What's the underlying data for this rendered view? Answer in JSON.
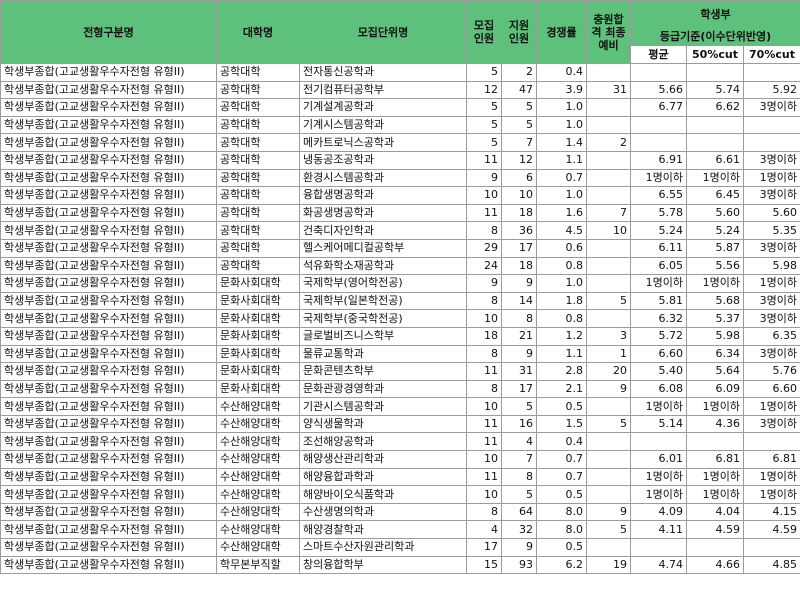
{
  "headers": {
    "track": "전형구분명",
    "college": "대학명",
    "unit": "모집단위명",
    "quota": "모집 인원",
    "applicants": "지원 인원",
    "ratio": "경쟁률",
    "waitlist": "충원합격 최종예비",
    "student_group": "학생부",
    "grade_basis": "등급기준(이수단위반영)",
    "avg": "평균",
    "cut50": "50%cut",
    "cut70": "70%cut"
  },
  "rows": [
    [
      "학생부종합(고교생활우수자전형 유형II)",
      "공학대학",
      "전자통신공학과",
      "5",
      "2",
      "0.4",
      "",
      "",
      "",
      ""
    ],
    [
      "학생부종합(고교생활우수자전형 유형II)",
      "공학대학",
      "전기컴퓨터공학부",
      "12",
      "47",
      "3.9",
      "31",
      "5.66",
      "5.74",
      "5.92"
    ],
    [
      "학생부종합(고교생활우수자전형 유형II)",
      "공학대학",
      "기계설계공학과",
      "5",
      "5",
      "1.0",
      "",
      "6.77",
      "6.62",
      "3명이하"
    ],
    [
      "학생부종합(고교생활우수자전형 유형II)",
      "공학대학",
      "기계시스템공학과",
      "5",
      "5",
      "1.0",
      "",
      "",
      "",
      ""
    ],
    [
      "학생부종합(고교생활우수자전형 유형II)",
      "공학대학",
      "메카트로닉스공학과",
      "5",
      "7",
      "1.4",
      "2",
      "",
      "",
      ""
    ],
    [
      "학생부종합(고교생활우수자전형 유형II)",
      "공학대학",
      "냉동공조공학과",
      "11",
      "12",
      "1.1",
      "",
      "6.91",
      "6.61",
      "3명이하"
    ],
    [
      "학생부종합(고교생활우수자전형 유형II)",
      "공학대학",
      "환경시스템공학과",
      "9",
      "6",
      "0.7",
      "",
      "1명이하",
      "1명이하",
      "1명이하"
    ],
    [
      "학생부종합(고교생활우수자전형 유형II)",
      "공학대학",
      "융합생명공학과",
      "10",
      "10",
      "1.0",
      "",
      "6.55",
      "6.45",
      "3명이하"
    ],
    [
      "학생부종합(고교생활우수자전형 유형II)",
      "공학대학",
      "화공생명공학과",
      "11",
      "18",
      "1.6",
      "7",
      "5.78",
      "5.60",
      "5.60"
    ],
    [
      "학생부종합(고교생활우수자전형 유형II)",
      "공학대학",
      "건축디자인학과",
      "8",
      "36",
      "4.5",
      "10",
      "5.24",
      "5.24",
      "5.35"
    ],
    [
      "학생부종합(고교생활우수자전형 유형II)",
      "공학대학",
      "헬스케어메디컬공학부",
      "29",
      "17",
      "0.6",
      "",
      "6.11",
      "5.87",
      "3명이하"
    ],
    [
      "학생부종합(고교생활우수자전형 유형II)",
      "공학대학",
      "석유화학소재공학과",
      "24",
      "18",
      "0.8",
      "",
      "6.05",
      "5.56",
      "5.98"
    ],
    [
      "학생부종합(고교생활우수자전형 유형II)",
      "문화사회대학",
      "국제학부(영어학전공)",
      "9",
      "9",
      "1.0",
      "",
      "1명이하",
      "1명이하",
      "1명이하"
    ],
    [
      "학생부종합(고교생활우수자전형 유형II)",
      "문화사회대학",
      "국제학부(일본학전공)",
      "8",
      "14",
      "1.8",
      "5",
      "5.81",
      "5.68",
      "3명이하"
    ],
    [
      "학생부종합(고교생활우수자전형 유형II)",
      "문화사회대학",
      "국제학부(중국학전공)",
      "10",
      "8",
      "0.8",
      "",
      "6.32",
      "5.37",
      "3명이하"
    ],
    [
      "학생부종합(고교생활우수자전형 유형II)",
      "문화사회대학",
      "글로벌비즈니스학부",
      "18",
      "21",
      "1.2",
      "3",
      "5.72",
      "5.98",
      "6.35"
    ],
    [
      "학생부종합(고교생활우수자전형 유형II)",
      "문화사회대학",
      "물류교통학과",
      "8",
      "9",
      "1.1",
      "1",
      "6.60",
      "6.34",
      "3명이하"
    ],
    [
      "학생부종합(고교생활우수자전형 유형II)",
      "문화사회대학",
      "문화콘텐츠학부",
      "11",
      "31",
      "2.8",
      "20",
      "5.40",
      "5.64",
      "5.76"
    ],
    [
      "학생부종합(고교생활우수자전형 유형II)",
      "문화사회대학",
      "문화관광경영학과",
      "8",
      "17",
      "2.1",
      "9",
      "6.08",
      "6.09",
      "6.60"
    ],
    [
      "학생부종합(고교생활우수자전형 유형II)",
      "수산해양대학",
      "기관시스템공학과",
      "10",
      "5",
      "0.5",
      "",
      "1명이하",
      "1명이하",
      "1명이하"
    ],
    [
      "학생부종합(고교생활우수자전형 유형II)",
      "수산해양대학",
      "양식생물학과",
      "11",
      "16",
      "1.5",
      "5",
      "5.14",
      "4.36",
      "3명이하"
    ],
    [
      "학생부종합(고교생활우수자전형 유형II)",
      "수산해양대학",
      "조선해양공학과",
      "11",
      "4",
      "0.4",
      "",
      "",
      "",
      ""
    ],
    [
      "학생부종합(고교생활우수자전형 유형II)",
      "수산해양대학",
      "해양생산관리학과",
      "10",
      "7",
      "0.7",
      "",
      "6.01",
      "6.81",
      "6.81"
    ],
    [
      "학생부종합(고교생활우수자전형 유형II)",
      "수산해양대학",
      "해양융합과학과",
      "11",
      "8",
      "0.7",
      "",
      "1명이하",
      "1명이하",
      "1명이하"
    ],
    [
      "학생부종합(고교생활우수자전형 유형II)",
      "수산해양대학",
      "해양바이오식품학과",
      "10",
      "5",
      "0.5",
      "",
      "1명이하",
      "1명이하",
      "1명이하"
    ],
    [
      "학생부종합(고교생활우수자전형 유형II)",
      "수산해양대학",
      "수산생명의학과",
      "8",
      "64",
      "8.0",
      "9",
      "4.09",
      "4.04",
      "4.15"
    ],
    [
      "학생부종합(고교생활우수자전형 유형II)",
      "수산해양대학",
      "해양경찰학과",
      "4",
      "32",
      "8.0",
      "5",
      "4.11",
      "4.59",
      "4.59"
    ],
    [
      "학생부종합(고교생활우수자전형 유형II)",
      "수산해양대학",
      "스마트수산자원관리학과",
      "17",
      "9",
      "0.5",
      "",
      "",
      "",
      ""
    ],
    [
      "학생부종합(고교생활우수자전형 유형II)",
      "학무본부직할",
      "창의융합학부",
      "15",
      "93",
      "6.2",
      "19",
      "4.74",
      "4.66",
      "4.85"
    ]
  ]
}
